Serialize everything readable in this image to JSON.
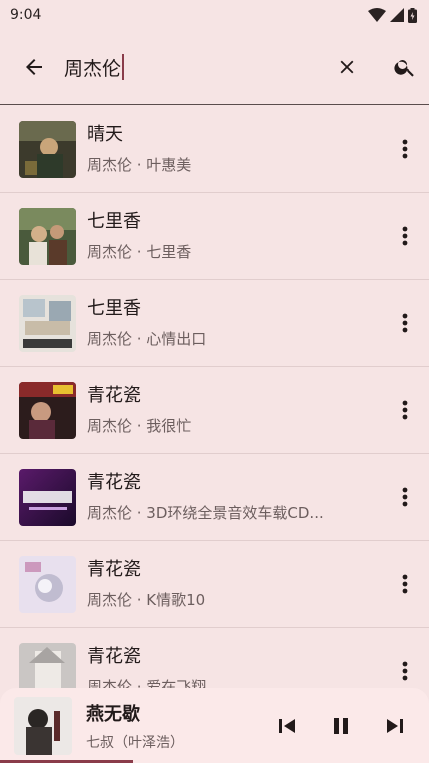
{
  "status": {
    "time": "9:04"
  },
  "search": {
    "value": "周杰伦",
    "placeholder": ""
  },
  "results": [
    {
      "title": "晴天",
      "subtitle": "周杰伦 · 叶惠美"
    },
    {
      "title": "七里香",
      "subtitle": "周杰伦 · 七里香"
    },
    {
      "title": "七里香",
      "subtitle": "周杰伦 · 心情出口"
    },
    {
      "title": "青花瓷",
      "subtitle": "周杰伦 · 我很忙"
    },
    {
      "title": "青花瓷",
      "subtitle": "周杰伦 · 3D环绕全景音效车载CD..."
    },
    {
      "title": "青花瓷",
      "subtitle": "周杰伦 · K情歌10"
    },
    {
      "title": "青花瓷",
      "subtitle": "周杰伦 · 爱在飞翔"
    }
  ],
  "player": {
    "title": "燕无歇",
    "artist": "七叔（叶泽浩）",
    "progress_fraction": 0.31,
    "icons": [
      "skip-previous-icon",
      "pause-icon",
      "skip-next-icon"
    ]
  },
  "colors": {
    "background": "#f6e4e4",
    "accent": "#8a3c4a",
    "player_background": "#fbe9e9"
  }
}
